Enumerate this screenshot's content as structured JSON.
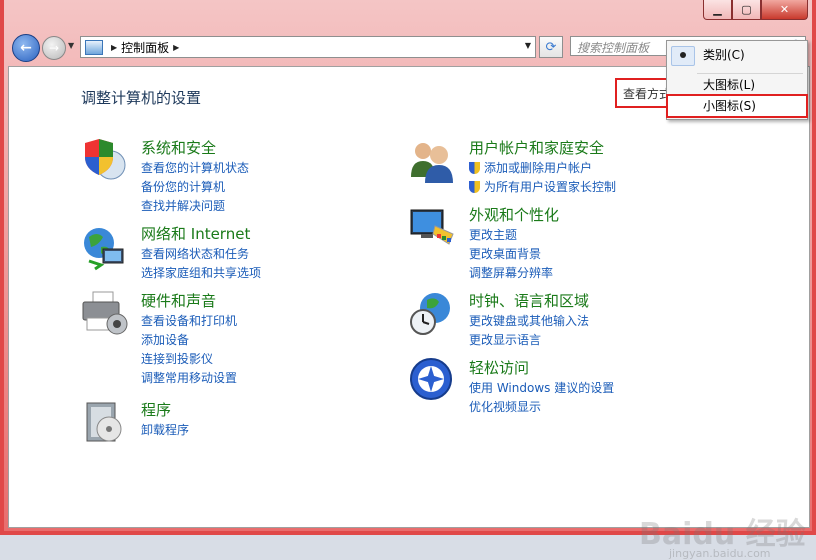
{
  "window": {
    "caption": {
      "minimize": "▁",
      "maximize": "▢",
      "close": "✕"
    }
  },
  "nav": {
    "address": {
      "segment": "控制面板"
    },
    "search_placeholder": "搜索控制面板"
  },
  "page": {
    "title": "调整计算机的设置"
  },
  "viewby": {
    "label": "查看方式:",
    "value": "类别"
  },
  "menu": {
    "items": [
      {
        "label": "类别(C)",
        "selected": true
      },
      {
        "label": "大图标(L)"
      },
      {
        "label": "小图标(S)",
        "highlighted": true
      }
    ]
  },
  "categories": [
    {
      "title": "系统和安全",
      "links": [
        "查看您的计算机状态",
        "备份您的计算机",
        "查找并解决问题"
      ]
    },
    {
      "title": "网络和 Internet",
      "links": [
        "查看网络状态和任务",
        "选择家庭组和共享选项"
      ]
    },
    {
      "title": "硬件和声音",
      "links": [
        "查看设备和打印机",
        "添加设备",
        "连接到投影仪",
        "调整常用移动设置"
      ]
    },
    {
      "title": "程序",
      "links": [
        "卸载程序"
      ]
    },
    {
      "title": "用户帐户和家庭安全",
      "links": [
        "添加或删除用户帐户",
        "为所有用户设置家长控制"
      ]
    },
    {
      "title": "外观和个性化",
      "links": [
        "更改主题",
        "更改桌面背景",
        "调整屏幕分辨率"
      ]
    },
    {
      "title": "时钟、语言和区域",
      "links": [
        "更改键盘或其他输入法",
        "更改显示语言"
      ]
    },
    {
      "title": "轻松访问",
      "links": [
        "使用 Windows 建议的设置",
        "优化视频显示"
      ]
    }
  ],
  "watermark": {
    "logo": "Baidu 经验",
    "url": "jingyan.baidu.com"
  }
}
